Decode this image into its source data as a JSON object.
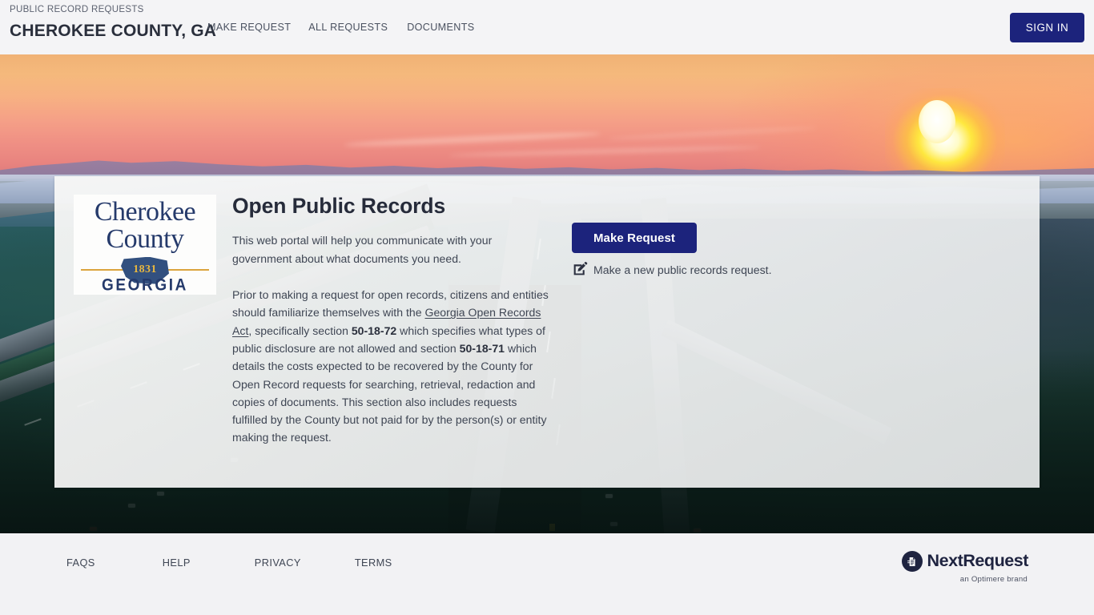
{
  "header": {
    "eyebrow": "PUBLIC RECORD REQUESTS",
    "agency": "CHEROKEE COUNTY, GA",
    "nav": [
      {
        "label": "MAKE REQUEST"
      },
      {
        "label": "ALL REQUESTS"
      },
      {
        "label": "DOCUMENTS"
      }
    ],
    "signin_label": "SIGN IN"
  },
  "seal": {
    "line1": "Cherokee",
    "line2": "County",
    "year": "1831",
    "state": "GEORGIA"
  },
  "hero": {
    "title": "Open Public Records",
    "intro": "This web portal will help you communicate with your government about what documents you need.",
    "body": {
      "part1": "Prior to making a request for open records, citizens and entities should familiarize themselves with the ",
      "link": "Georgia Open Records Act",
      "part2": ", specifically section ",
      "code1": "50-18-72",
      "part3": " which specifies what types of public disclosure are not allowed and section ",
      "code2": "50-18-71",
      "part4": " which details the costs expected to be recovered by the County for Open Record requests for searching, retrieval, redaction and copies of documents. This section also includes requests fulfilled by the County but not paid for by the person(s) or entity making the request."
    },
    "make_request_label": "Make Request",
    "make_request_desc": "Make a new public records request.",
    "make_request_icon": "edit-pencil-square-icon"
  },
  "footer": {
    "links": [
      {
        "label": "FAQS"
      },
      {
        "label": "HELP"
      },
      {
        "label": "PRIVACY"
      },
      {
        "label": "TERMS"
      }
    ],
    "brand": "NextRequest",
    "brand_tagline": "an Optimere brand",
    "brand_icon": "document-circle-icon"
  },
  "colors": {
    "primary_navy": "#1c237c",
    "text_dark": "#2a2f3c",
    "body_text": "#3f4654",
    "seal_navy": "#253a6b",
    "seal_gold": "#dba43d",
    "page_bg": "#f2f2f4",
    "card_bg": "#f5f5f4"
  }
}
